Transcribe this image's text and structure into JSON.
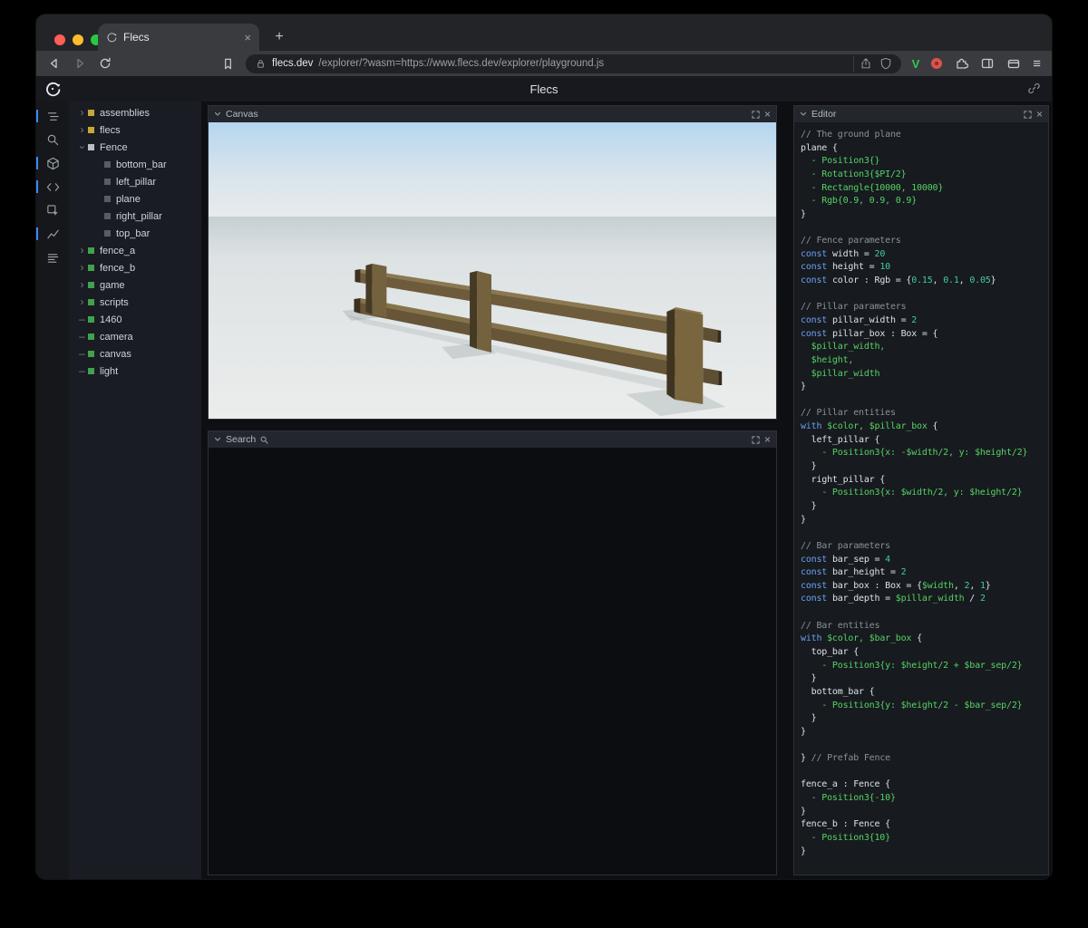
{
  "browser": {
    "tab_title": "Flecs",
    "new_tab_label": "+",
    "url_host": "flecs.dev",
    "url_rest": "/explorer/?wasm=https://www.flecs.dev/explorer/playground.js",
    "menu_glyph": "≡",
    "v_ext_label": "V"
  },
  "app": {
    "title": "Flecs",
    "canvas_title": "Canvas",
    "search_title": "Search",
    "editor_title": "Editor",
    "close_glyph": "×"
  },
  "colors": {
    "traffic_red": "#ff5f57",
    "traffic_yellow": "#febc2e",
    "traffic_green": "#28c840",
    "accent_blue": "#3d8bff",
    "entity_green": "#3fa24f",
    "entity_yellow": "#c9a63a",
    "module_gray": "#b9bfc6",
    "child_gray": "#565d66"
  },
  "tree": {
    "items": [
      {
        "label": "assemblies",
        "color": "#c9a63a",
        "arrow": "collapsed",
        "level": 0
      },
      {
        "label": "flecs",
        "color": "#c9a63a",
        "arrow": "collapsed",
        "level": 0
      },
      {
        "label": "Fence",
        "color": "#b9bfc6",
        "arrow": "expanded",
        "level": 0
      },
      {
        "label": "bottom_bar",
        "color": "#565d66",
        "arrow": "none",
        "level": 1
      },
      {
        "label": "left_pillar",
        "color": "#565d66",
        "arrow": "none",
        "level": 1
      },
      {
        "label": "plane",
        "color": "#565d66",
        "arrow": "none",
        "level": 1
      },
      {
        "label": "right_pillar",
        "color": "#565d66",
        "arrow": "none",
        "level": 1
      },
      {
        "label": "top_bar",
        "color": "#565d66",
        "arrow": "none",
        "level": 1
      },
      {
        "label": "fence_a",
        "color": "#3fa24f",
        "arrow": "collapsed",
        "level": 0
      },
      {
        "label": "fence_b",
        "color": "#3fa24f",
        "arrow": "collapsed",
        "level": 0
      },
      {
        "label": "game",
        "color": "#3fa24f",
        "arrow": "collapsed",
        "level": 0
      },
      {
        "label": "scripts",
        "color": "#3fa24f",
        "arrow": "collapsed",
        "level": 0
      },
      {
        "label": "1460",
        "color": "#3fa24f",
        "arrow": "leaf",
        "level": 0
      },
      {
        "label": "camera",
        "color": "#3fa24f",
        "arrow": "leaf",
        "level": 0
      },
      {
        "label": "canvas",
        "color": "#3fa24f",
        "arrow": "leaf",
        "level": 0
      },
      {
        "label": "light",
        "color": "#3fa24f",
        "arrow": "leaf",
        "level": 0
      }
    ]
  },
  "editor": {
    "lines": [
      [
        [
          "c",
          "// The ground plane"
        ]
      ],
      [
        [
          "p",
          "plane {"
        ]
      ],
      [
        [
          "g",
          "  - Position3{}"
        ]
      ],
      [
        [
          "g",
          "  - Rotation3{$PI/2}"
        ]
      ],
      [
        [
          "g",
          "  - Rectangle{10000, 10000}"
        ]
      ],
      [
        [
          "g",
          "  - Rgb{0.9, 0.9, 0.9}"
        ]
      ],
      [
        [
          "p",
          "}"
        ]
      ],
      [],
      [
        [
          "c",
          "// Fence parameters"
        ]
      ],
      [
        [
          "k",
          "const "
        ],
        [
          "p",
          "width = "
        ],
        [
          "n",
          "20"
        ]
      ],
      [
        [
          "k",
          "const "
        ],
        [
          "p",
          "height = "
        ],
        [
          "n",
          "10"
        ]
      ],
      [
        [
          "k",
          "const "
        ],
        [
          "p",
          "color : Rgb = {"
        ],
        [
          "n",
          "0.15"
        ],
        [
          "p",
          ", "
        ],
        [
          "n",
          "0.1"
        ],
        [
          "p",
          ", "
        ],
        [
          "n",
          "0.05"
        ],
        [
          "p",
          "}"
        ]
      ],
      [],
      [
        [
          "c",
          "// Pillar parameters"
        ]
      ],
      [
        [
          "k",
          "const "
        ],
        [
          "p",
          "pillar_width = "
        ],
        [
          "n",
          "2"
        ]
      ],
      [
        [
          "k",
          "const "
        ],
        [
          "p",
          "pillar_box : Box = {"
        ]
      ],
      [
        [
          "g",
          "  $pillar_width,"
        ]
      ],
      [
        [
          "g",
          "  $height,"
        ]
      ],
      [
        [
          "g",
          "  $pillar_width"
        ]
      ],
      [
        [
          "p",
          "}"
        ]
      ],
      [],
      [
        [
          "c",
          "// Pillar entities"
        ]
      ],
      [
        [
          "k",
          "with "
        ],
        [
          "g",
          "$color, $pillar_box"
        ],
        [
          "p",
          " {"
        ]
      ],
      [
        [
          "p",
          "  left_pillar {"
        ]
      ],
      [
        [
          "g",
          "    - Position3{x: -$width/2, y: $height/2}"
        ]
      ],
      [
        [
          "p",
          "  }"
        ]
      ],
      [
        [
          "p",
          "  right_pillar {"
        ]
      ],
      [
        [
          "g",
          "    - Position3{x: $width/2, y: $height/2}"
        ]
      ],
      [
        [
          "p",
          "  }"
        ]
      ],
      [
        [
          "p",
          "}"
        ]
      ],
      [],
      [
        [
          "c",
          "// Bar parameters"
        ]
      ],
      [
        [
          "k",
          "const "
        ],
        [
          "p",
          "bar_sep = "
        ],
        [
          "n",
          "4"
        ]
      ],
      [
        [
          "k",
          "const "
        ],
        [
          "p",
          "bar_height = "
        ],
        [
          "n",
          "2"
        ]
      ],
      [
        [
          "k",
          "const "
        ],
        [
          "p",
          "bar_box : Box = {"
        ],
        [
          "g",
          "$width"
        ],
        [
          "p",
          ", "
        ],
        [
          "n",
          "2"
        ],
        [
          "p",
          ", "
        ],
        [
          "n",
          "1"
        ],
        [
          "p",
          "}"
        ]
      ],
      [
        [
          "k",
          "const "
        ],
        [
          "p",
          "bar_depth = "
        ],
        [
          "g",
          "$pillar_width"
        ],
        [
          "p",
          " / "
        ],
        [
          "n",
          "2"
        ]
      ],
      [],
      [
        [
          "c",
          "// Bar entities"
        ]
      ],
      [
        [
          "k",
          "with "
        ],
        [
          "g",
          "$color, $bar_box"
        ],
        [
          "p",
          " {"
        ]
      ],
      [
        [
          "p",
          "  top_bar {"
        ]
      ],
      [
        [
          "g",
          "    - Position3{y: $height/2 + $bar_sep/2}"
        ]
      ],
      [
        [
          "p",
          "  }"
        ]
      ],
      [
        [
          "p",
          "  bottom_bar {"
        ]
      ],
      [
        [
          "g",
          "    - Position3{y: $height/2 - $bar_sep/2}"
        ]
      ],
      [
        [
          "p",
          "  }"
        ]
      ],
      [
        [
          "p",
          "}"
        ]
      ],
      [],
      [
        [
          "p",
          "} "
        ],
        [
          "c",
          "// Prefab Fence"
        ]
      ],
      [],
      [
        [
          "p",
          "fence_a : Fence {"
        ]
      ],
      [
        [
          "g",
          "  - Position3{-10}"
        ]
      ],
      [
        [
          "p",
          "}"
        ]
      ],
      [
        [
          "p",
          "fence_b : Fence {"
        ]
      ],
      [
        [
          "g",
          "  - Position3{10}"
        ]
      ],
      [
        [
          "p",
          "}"
        ]
      ]
    ]
  }
}
